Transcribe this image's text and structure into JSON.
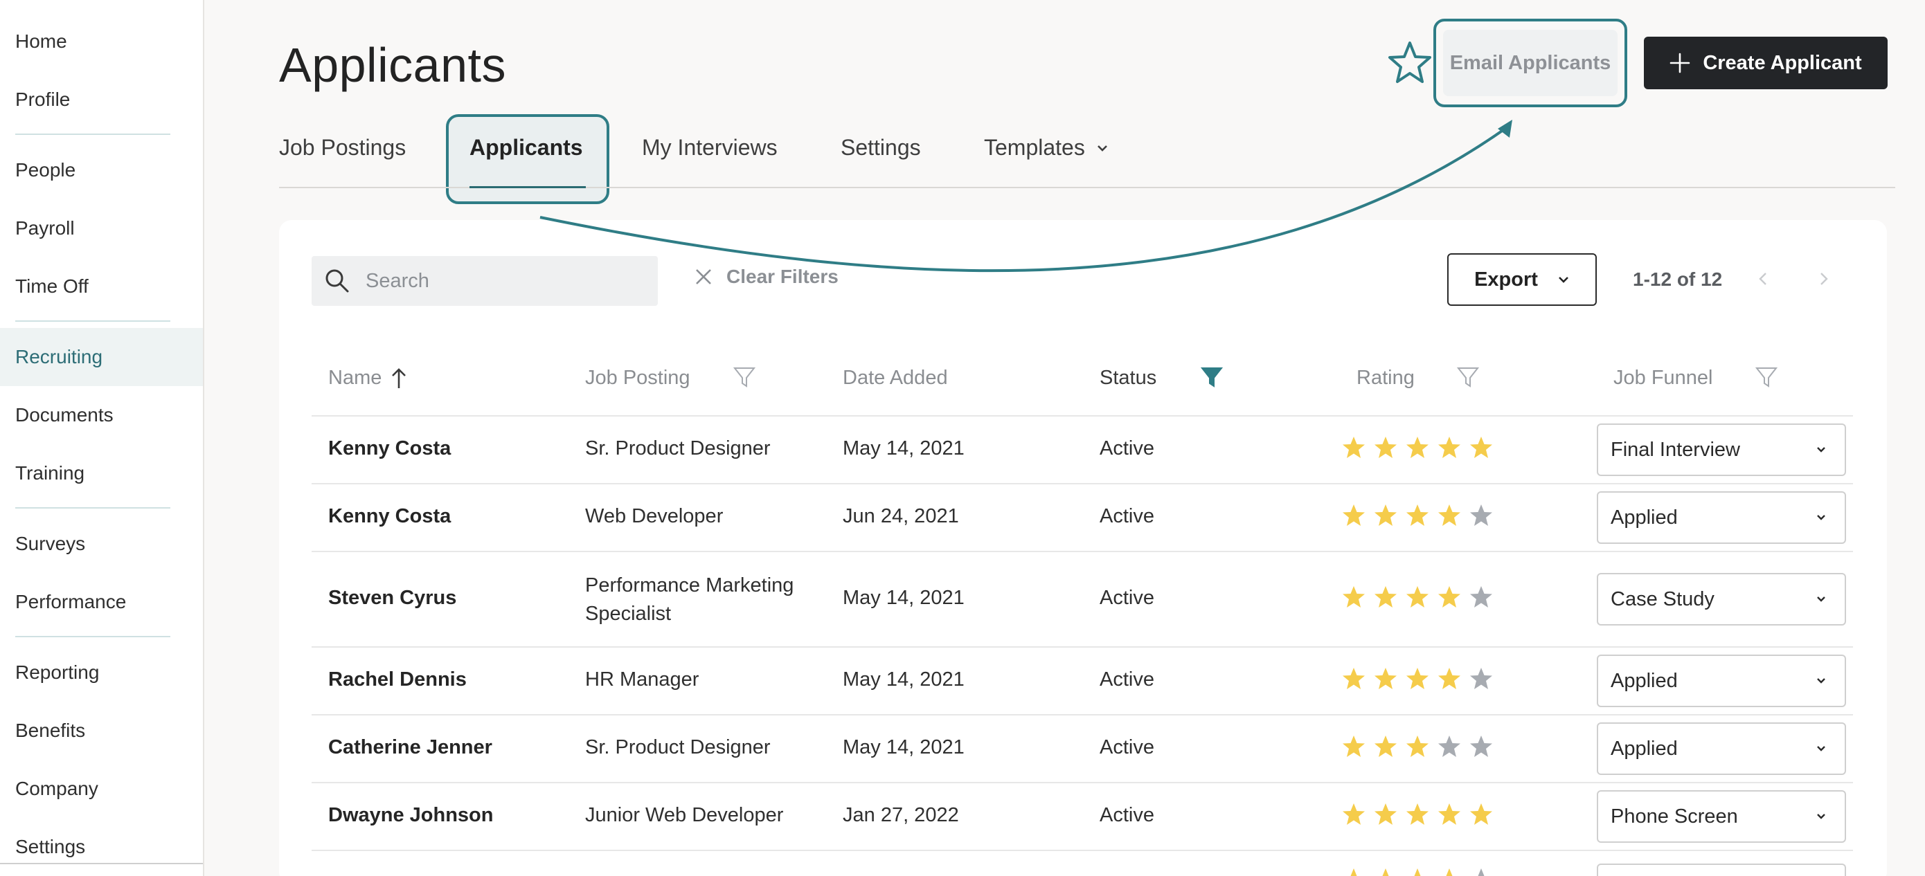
{
  "sidebar": {
    "items": [
      {
        "label": "Home"
      },
      {
        "label": "Profile"
      },
      {
        "label": "People"
      },
      {
        "label": "Payroll"
      },
      {
        "label": "Time Off"
      },
      {
        "label": "Recruiting",
        "active": true
      },
      {
        "label": "Documents"
      },
      {
        "label": "Training"
      },
      {
        "label": "Surveys"
      },
      {
        "label": "Performance"
      },
      {
        "label": "Reporting"
      },
      {
        "label": "Benefits"
      },
      {
        "label": "Company"
      },
      {
        "label": "Settings"
      }
    ]
  },
  "header": {
    "title": "Applicants",
    "email_label": "Email Applicants",
    "create_label": "Create Applicant"
  },
  "tabs": [
    {
      "label": "Job Postings"
    },
    {
      "label": "Applicants",
      "active": true
    },
    {
      "label": "My Interviews"
    },
    {
      "label": "Settings"
    },
    {
      "label": "Templates"
    }
  ],
  "toolbar": {
    "search_placeholder": "Search",
    "clear_filters": "Clear Filters",
    "export_label": "Export",
    "pager": "1-12 of 12"
  },
  "table": {
    "columns": [
      "Name",
      "Job Posting",
      "Date Added",
      "Status",
      "Rating",
      "Job Funnel"
    ],
    "rows": [
      {
        "name": "Kenny Costa",
        "job": "Sr. Product Designer",
        "date": "May 14, 2021",
        "status": "Active",
        "rating": 5,
        "funnel": "Final Interview"
      },
      {
        "name": "Kenny Costa",
        "job": "Web Developer",
        "date": "Jun 24, 2021",
        "status": "Active",
        "rating": 4,
        "funnel": "Applied"
      },
      {
        "name": "Steven Cyrus",
        "job": "Performance Marketing Specialist",
        "date": "May 14, 2021",
        "status": "Active",
        "rating": 4,
        "funnel": "Case Study"
      },
      {
        "name": "Rachel Dennis",
        "job": "HR Manager",
        "date": "May 14, 2021",
        "status": "Active",
        "rating": 4,
        "funnel": "Applied"
      },
      {
        "name": "Catherine Jenner",
        "job": "Sr. Product Designer",
        "date": "May 14, 2021",
        "status": "Active",
        "rating": 3,
        "funnel": "Applied"
      },
      {
        "name": "Dwayne Johnson",
        "job": "Junior Web Developer",
        "date": "Jan 27, 2022",
        "status": "Active",
        "rating": 5,
        "funnel": "Phone Screen"
      }
    ]
  },
  "colors": {
    "accent": "#2f7d86",
    "star_filled": "#f5cc4b",
    "star_empty": "#a7abb1",
    "dark_button": "#232528"
  }
}
